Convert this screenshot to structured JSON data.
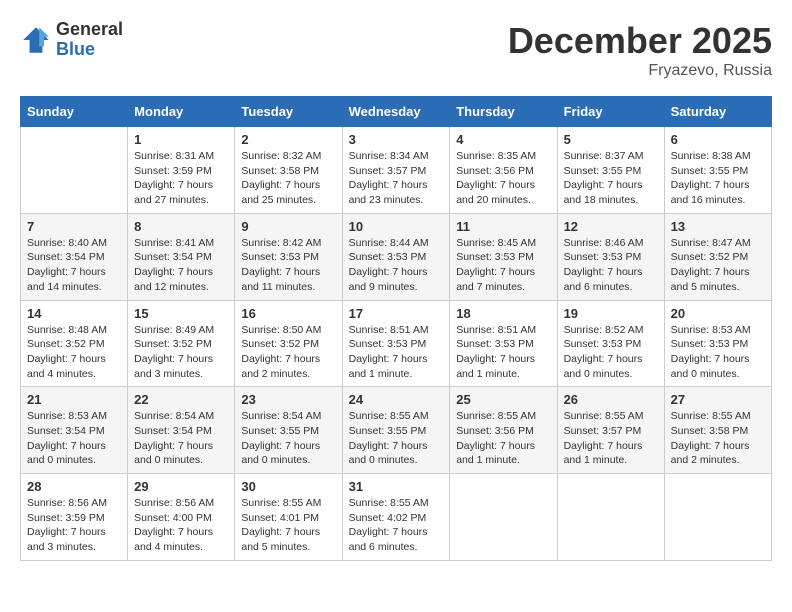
{
  "header": {
    "logo_general": "General",
    "logo_blue": "Blue",
    "month_title": "December 2025",
    "location": "Fryazevo, Russia"
  },
  "calendar": {
    "days_of_week": [
      "Sunday",
      "Monday",
      "Tuesday",
      "Wednesday",
      "Thursday",
      "Friday",
      "Saturday"
    ],
    "weeks": [
      [
        {
          "day": "",
          "info": ""
        },
        {
          "day": "1",
          "info": "Sunrise: 8:31 AM\nSunset: 3:59 PM\nDaylight: 7 hours\nand 27 minutes."
        },
        {
          "day": "2",
          "info": "Sunrise: 8:32 AM\nSunset: 3:58 PM\nDaylight: 7 hours\nand 25 minutes."
        },
        {
          "day": "3",
          "info": "Sunrise: 8:34 AM\nSunset: 3:57 PM\nDaylight: 7 hours\nand 23 minutes."
        },
        {
          "day": "4",
          "info": "Sunrise: 8:35 AM\nSunset: 3:56 PM\nDaylight: 7 hours\nand 20 minutes."
        },
        {
          "day": "5",
          "info": "Sunrise: 8:37 AM\nSunset: 3:55 PM\nDaylight: 7 hours\nand 18 minutes."
        },
        {
          "day": "6",
          "info": "Sunrise: 8:38 AM\nSunset: 3:55 PM\nDaylight: 7 hours\nand 16 minutes."
        }
      ],
      [
        {
          "day": "7",
          "info": "Sunrise: 8:40 AM\nSunset: 3:54 PM\nDaylight: 7 hours\nand 14 minutes."
        },
        {
          "day": "8",
          "info": "Sunrise: 8:41 AM\nSunset: 3:54 PM\nDaylight: 7 hours\nand 12 minutes."
        },
        {
          "day": "9",
          "info": "Sunrise: 8:42 AM\nSunset: 3:53 PM\nDaylight: 7 hours\nand 11 minutes."
        },
        {
          "day": "10",
          "info": "Sunrise: 8:44 AM\nSunset: 3:53 PM\nDaylight: 7 hours\nand 9 minutes."
        },
        {
          "day": "11",
          "info": "Sunrise: 8:45 AM\nSunset: 3:53 PM\nDaylight: 7 hours\nand 7 minutes."
        },
        {
          "day": "12",
          "info": "Sunrise: 8:46 AM\nSunset: 3:53 PM\nDaylight: 7 hours\nand 6 minutes."
        },
        {
          "day": "13",
          "info": "Sunrise: 8:47 AM\nSunset: 3:52 PM\nDaylight: 7 hours\nand 5 minutes."
        }
      ],
      [
        {
          "day": "14",
          "info": "Sunrise: 8:48 AM\nSunset: 3:52 PM\nDaylight: 7 hours\nand 4 minutes."
        },
        {
          "day": "15",
          "info": "Sunrise: 8:49 AM\nSunset: 3:52 PM\nDaylight: 7 hours\nand 3 minutes."
        },
        {
          "day": "16",
          "info": "Sunrise: 8:50 AM\nSunset: 3:52 PM\nDaylight: 7 hours\nand 2 minutes."
        },
        {
          "day": "17",
          "info": "Sunrise: 8:51 AM\nSunset: 3:53 PM\nDaylight: 7 hours\nand 1 minute."
        },
        {
          "day": "18",
          "info": "Sunrise: 8:51 AM\nSunset: 3:53 PM\nDaylight: 7 hours\nand 1 minute."
        },
        {
          "day": "19",
          "info": "Sunrise: 8:52 AM\nSunset: 3:53 PM\nDaylight: 7 hours\nand 0 minutes."
        },
        {
          "day": "20",
          "info": "Sunrise: 8:53 AM\nSunset: 3:53 PM\nDaylight: 7 hours\nand 0 minutes."
        }
      ],
      [
        {
          "day": "21",
          "info": "Sunrise: 8:53 AM\nSunset: 3:54 PM\nDaylight: 7 hours\nand 0 minutes."
        },
        {
          "day": "22",
          "info": "Sunrise: 8:54 AM\nSunset: 3:54 PM\nDaylight: 7 hours\nand 0 minutes."
        },
        {
          "day": "23",
          "info": "Sunrise: 8:54 AM\nSunset: 3:55 PM\nDaylight: 7 hours\nand 0 minutes."
        },
        {
          "day": "24",
          "info": "Sunrise: 8:55 AM\nSunset: 3:55 PM\nDaylight: 7 hours\nand 0 minutes."
        },
        {
          "day": "25",
          "info": "Sunrise: 8:55 AM\nSunset: 3:56 PM\nDaylight: 7 hours\nand 1 minute."
        },
        {
          "day": "26",
          "info": "Sunrise: 8:55 AM\nSunset: 3:57 PM\nDaylight: 7 hours\nand 1 minute."
        },
        {
          "day": "27",
          "info": "Sunrise: 8:55 AM\nSunset: 3:58 PM\nDaylight: 7 hours\nand 2 minutes."
        }
      ],
      [
        {
          "day": "28",
          "info": "Sunrise: 8:56 AM\nSunset: 3:59 PM\nDaylight: 7 hours\nand 3 minutes."
        },
        {
          "day": "29",
          "info": "Sunrise: 8:56 AM\nSunset: 4:00 PM\nDaylight: 7 hours\nand 4 minutes."
        },
        {
          "day": "30",
          "info": "Sunrise: 8:55 AM\nSunset: 4:01 PM\nDaylight: 7 hours\nand 5 minutes."
        },
        {
          "day": "31",
          "info": "Sunrise: 8:55 AM\nSunset: 4:02 PM\nDaylight: 7 hours\nand 6 minutes."
        },
        {
          "day": "",
          "info": ""
        },
        {
          "day": "",
          "info": ""
        },
        {
          "day": "",
          "info": ""
        }
      ]
    ]
  }
}
